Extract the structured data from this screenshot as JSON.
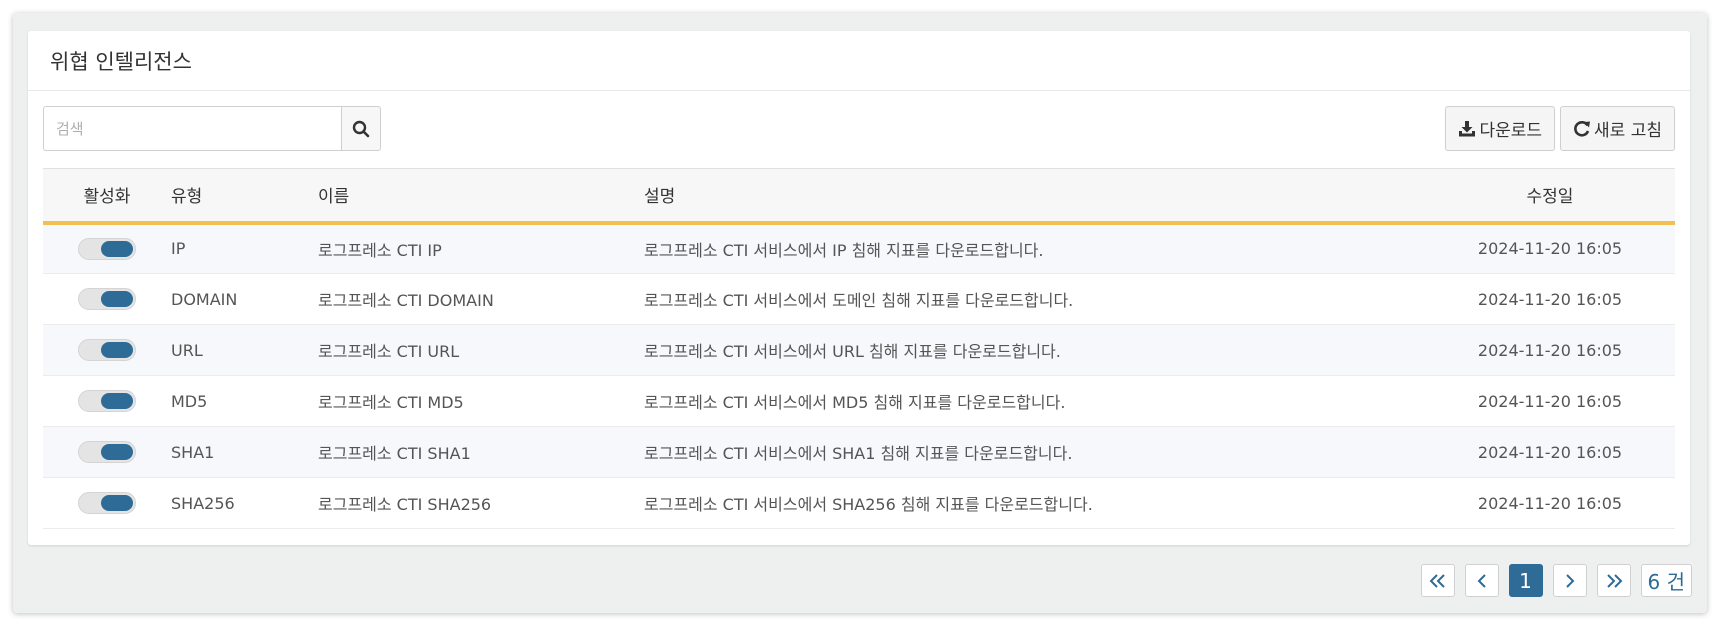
{
  "panel": {
    "title": "위협 인텔리전스"
  },
  "toolbar": {
    "search_placeholder": "검색",
    "search_value": "",
    "download_label": "다운로드",
    "refresh_label": "새로 고침"
  },
  "table": {
    "headers": {
      "active": "활성화",
      "type": "유형",
      "name": "이름",
      "desc": "설명",
      "date": "수정일"
    },
    "rows": [
      {
        "active": true,
        "type": "IP",
        "name": "로그프레소 CTI IP",
        "desc": "로그프레소 CTI 서비스에서 IP 침해 지표를 다운로드합니다.",
        "date": "2024-11-20 16:05"
      },
      {
        "active": true,
        "type": "DOMAIN",
        "name": "로그프레소 CTI DOMAIN",
        "desc": "로그프레소 CTI 서비스에서 도메인 침해 지표를 다운로드합니다.",
        "date": "2024-11-20 16:05"
      },
      {
        "active": true,
        "type": "URL",
        "name": "로그프레소 CTI URL",
        "desc": "로그프레소 CTI 서비스에서 URL 침해 지표를 다운로드합니다.",
        "date": "2024-11-20 16:05"
      },
      {
        "active": true,
        "type": "MD5",
        "name": "로그프레소 CTI MD5",
        "desc": "로그프레소 CTI 서비스에서 MD5 침해 지표를 다운로드합니다.",
        "date": "2024-11-20 16:05"
      },
      {
        "active": true,
        "type": "SHA1",
        "name": "로그프레소 CTI SHA1",
        "desc": "로그프레소 CTI 서비스에서 SHA1 침해 지표를 다운로드합니다.",
        "date": "2024-11-20 16:05"
      },
      {
        "active": true,
        "type": "SHA256",
        "name": "로그프레소 CTI SHA256",
        "desc": "로그프레소 CTI 서비스에서 SHA256 침해 지표를 다운로드합니다.",
        "date": "2024-11-20 16:05"
      }
    ]
  },
  "pagination": {
    "current_page": "1",
    "total_label": "6 건"
  },
  "colors": {
    "accent": "#2e6b96",
    "header_underline": "#f0c050"
  }
}
